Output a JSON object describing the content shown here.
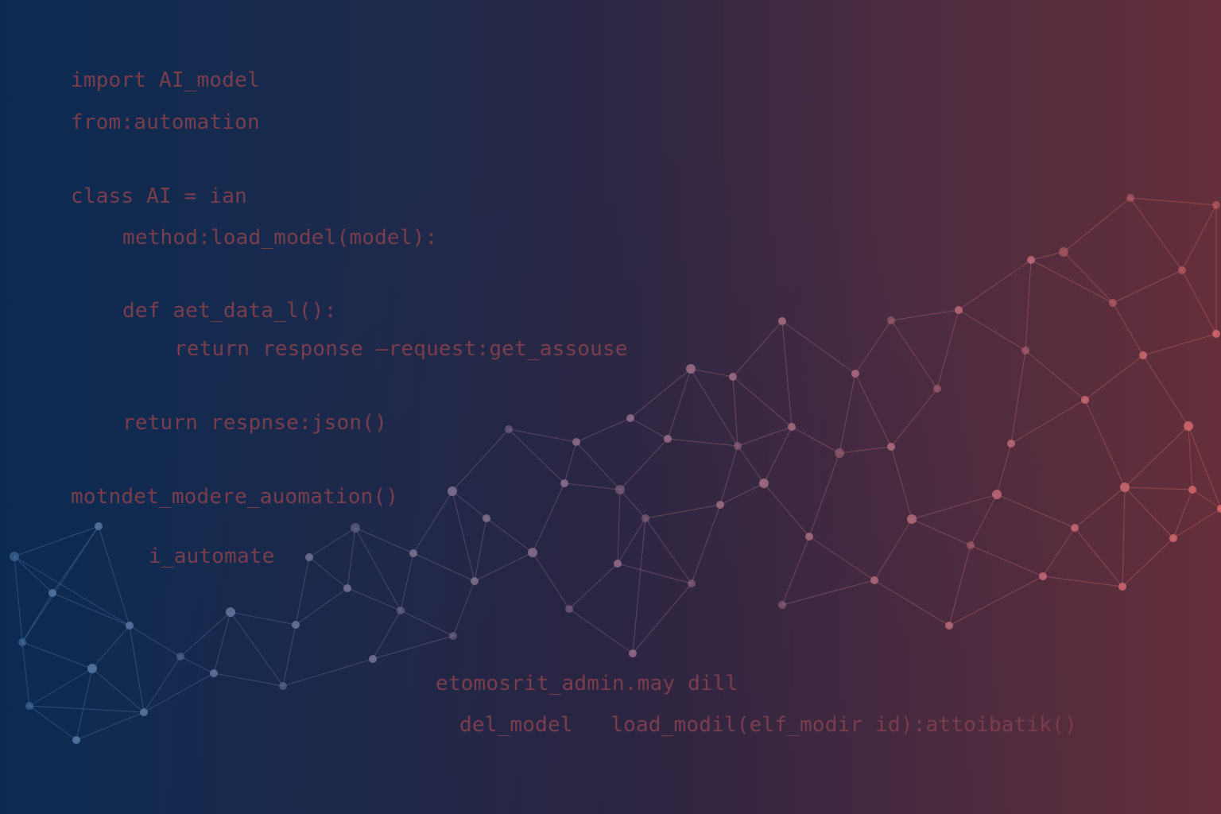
{
  "code": {
    "import_line": "import AI_model",
    "from_line": "from:automation",
    "class_line": "class AI = ian",
    "method_line": "method:load_model(model):",
    "def_line": "def aet_data_l():",
    "return_line_1": "return response –request:get_assouse",
    "return_line_2": "return respnse:json()",
    "call_line": "motndet_modere_auomation()",
    "automate_line": "i_automate",
    "admin_line": "etomosrit_admin.may dill",
    "del_line": "del_model   load_modil(elf_modir id):attoibatik()"
  },
  "colors": {
    "background_left": "#0b2a52",
    "background_right": "#642f3a",
    "code_text": "#7a3d4c",
    "node_blue": "#4d78a8",
    "node_red": "#d8676c"
  },
  "icons": [
    "network-mesh"
  ]
}
